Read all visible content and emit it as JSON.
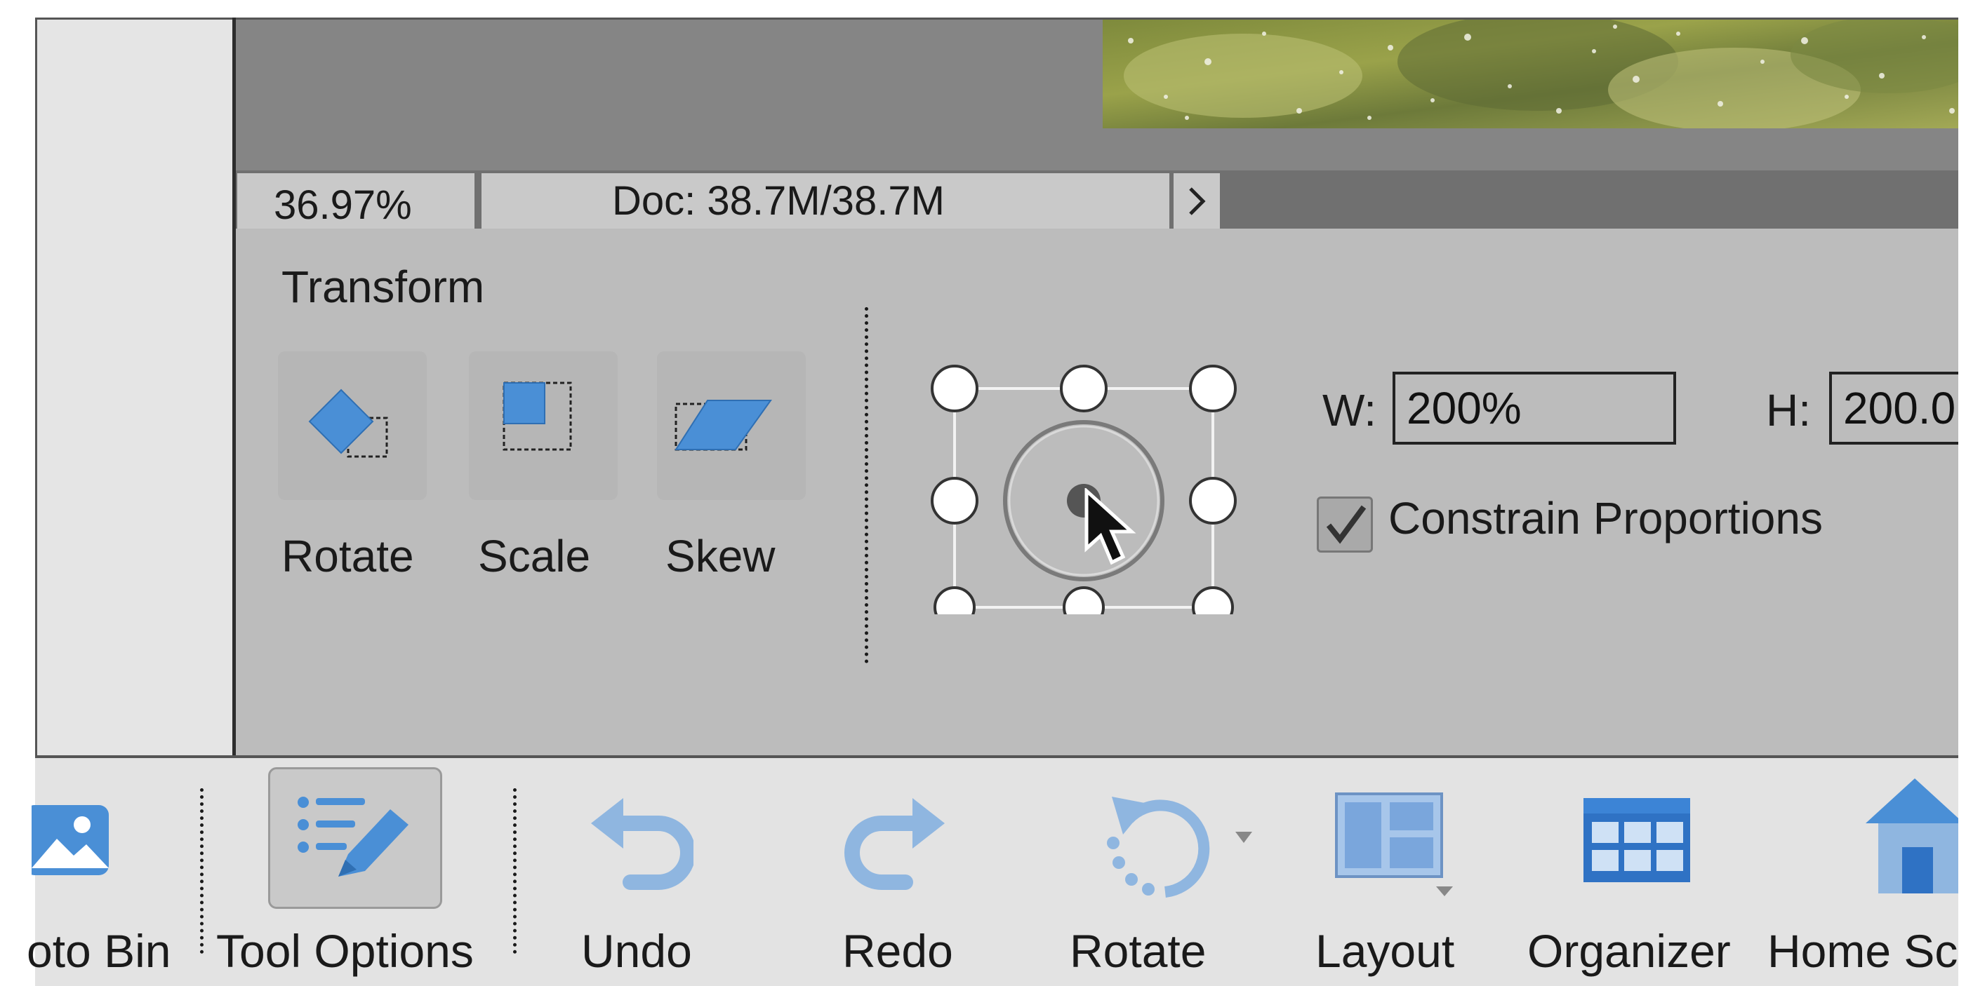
{
  "status": {
    "zoom": "36.97%",
    "doc_size": "Doc: 38.7M/38.7M",
    "arrow_icon": "chevron-right-icon"
  },
  "transform": {
    "title": "Transform",
    "tools": [
      {
        "label": "Rotate",
        "icon": "rotate-transform-icon"
      },
      {
        "label": "Scale",
        "icon": "scale-transform-icon"
      },
      {
        "label": "Skew",
        "icon": "skew-transform-icon"
      }
    ],
    "width_label": "W:",
    "width_value": "200%",
    "height_label": "H:",
    "height_value": "200.0",
    "constrain_label": "Constrain Proportions",
    "constrain_checked": true
  },
  "taskbar": {
    "items": [
      {
        "label": "oto Bin",
        "icon": "photo-bin-icon"
      },
      {
        "label": "Tool Options",
        "icon": "tool-options-icon"
      },
      {
        "label": "Undo",
        "icon": "undo-icon"
      },
      {
        "label": "Redo",
        "icon": "redo-icon"
      },
      {
        "label": "Rotate",
        "icon": "rotate-icon"
      },
      {
        "label": "Layout",
        "icon": "layout-icon"
      },
      {
        "label": "Organizer",
        "icon": "organizer-icon"
      },
      {
        "label": "Home Sc",
        "icon": "home-icon"
      }
    ]
  },
  "colors": {
    "icon_blue": "#4a8fd6",
    "icon_light_blue": "#8fb6e0"
  }
}
